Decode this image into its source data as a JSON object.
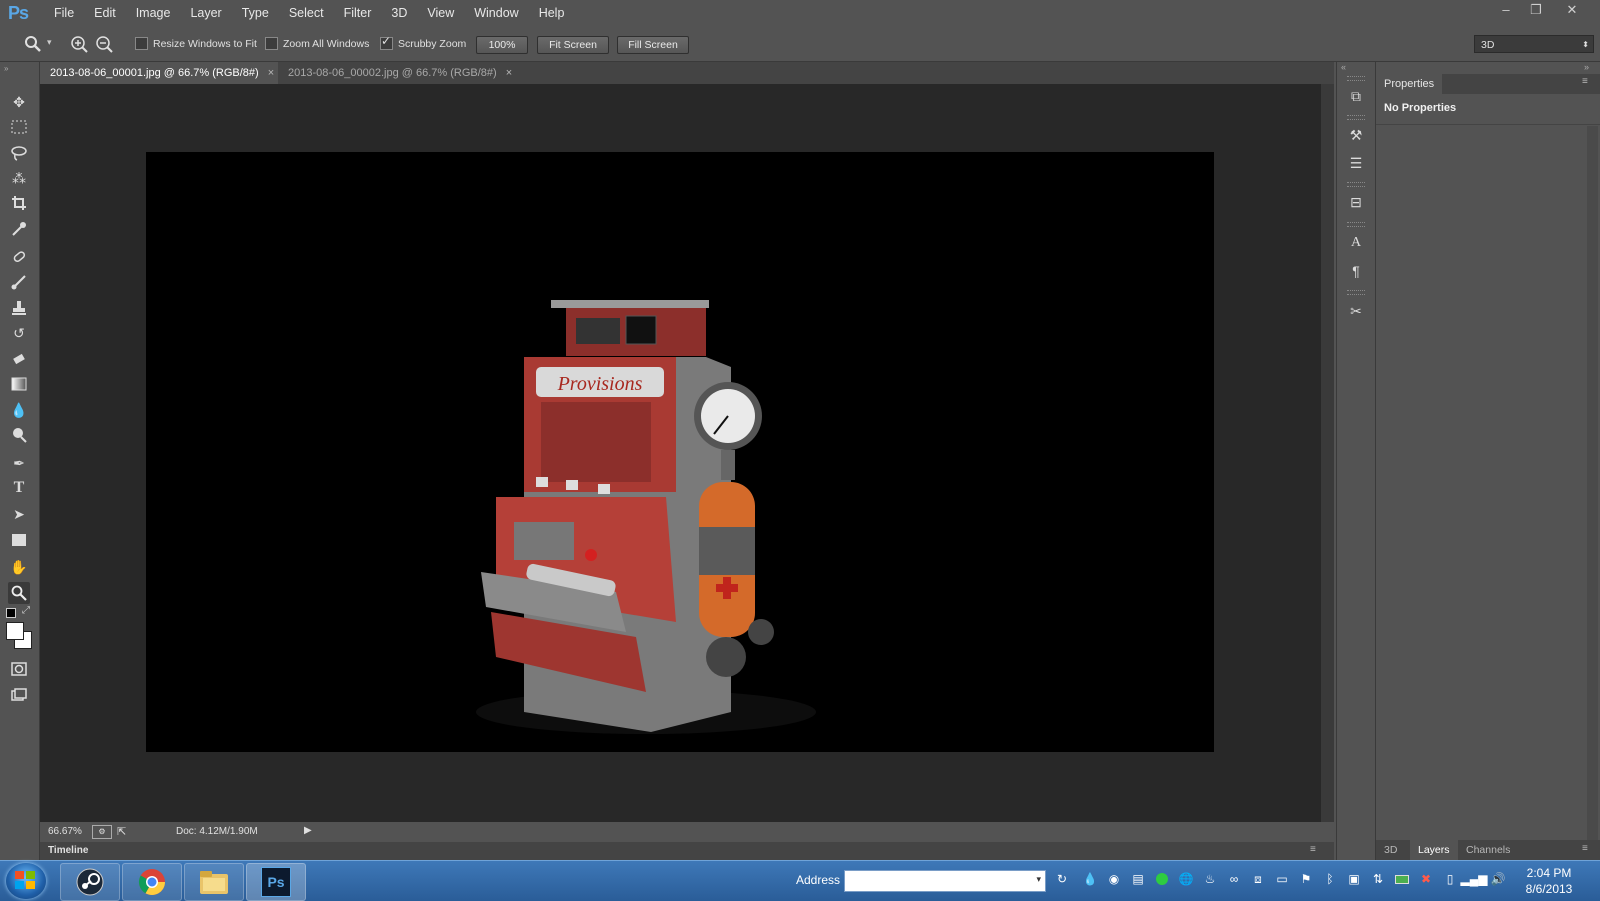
{
  "app": {
    "logo": "Ps"
  },
  "menu": [
    "File",
    "Edit",
    "Image",
    "Layer",
    "Type",
    "Select",
    "Filter",
    "3D",
    "View",
    "Window",
    "Help"
  ],
  "window_controls": {
    "minimize": "–",
    "restore": "❐",
    "close": "✕"
  },
  "options_bar": {
    "resize_windows": {
      "label": "Resize Windows to Fit",
      "checked": false
    },
    "zoom_all": {
      "label": "Zoom All Windows",
      "checked": false
    },
    "scrubby_zoom": {
      "label": "Scrubby Zoom",
      "checked": true
    },
    "btn_100": "100%",
    "btn_fit": "Fit Screen",
    "btn_fill": "Fill Screen",
    "workspace": "3D"
  },
  "tabs": [
    {
      "label": "2013-08-06_00001.jpg @ 66.7% (RGB/8#)",
      "active": true
    },
    {
      "label": "2013-08-06_00002.jpg @ 66.7% (RGB/8#)",
      "active": false
    }
  ],
  "canvas": {
    "sign_text": "Provisions"
  },
  "status": {
    "zoom": "66.67%",
    "doc": "Doc: 4.12M/1.90M"
  },
  "timeline_label": "Timeline",
  "properties": {
    "tab": "Properties",
    "title": "No Properties"
  },
  "panel_tabs": [
    "3D",
    "Layers",
    "Channels"
  ],
  "taskbar": {
    "address_label": "Address",
    "time": "2:04 PM",
    "date": "8/6/2013"
  },
  "colors": {
    "ui_bg": "#535353",
    "doc_bg": "#282828",
    "canvas": "#000000",
    "taskbar": "#2a5d98"
  }
}
